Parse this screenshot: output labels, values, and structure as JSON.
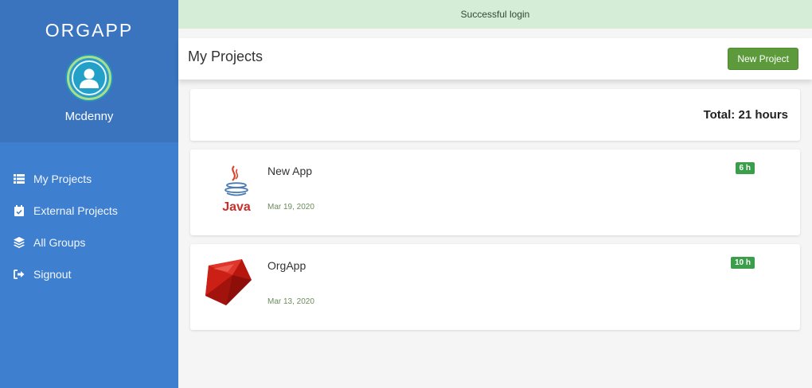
{
  "flash": {
    "message": "Successful login"
  },
  "sidebar": {
    "brand": "ORGAPP",
    "username": "Mcdenny",
    "items": [
      {
        "label": "My Projects",
        "icon": "list-icon"
      },
      {
        "label": "External Projects",
        "icon": "calendar-check-icon"
      },
      {
        "label": "All Groups",
        "icon": "layers-icon"
      },
      {
        "label": "Signout",
        "icon": "signout-icon"
      }
    ]
  },
  "header": {
    "title": "My Projects",
    "new_button": "New Project"
  },
  "summary": {
    "total": "Total: 21 hours"
  },
  "projects": [
    {
      "name": "New App",
      "date": "Mar 19, 2020",
      "hours": "6 h",
      "logo": "java-logo",
      "logo_text": "Java"
    },
    {
      "name": "OrgApp",
      "date": "Mar 13, 2020",
      "hours": "10 h",
      "logo": "ruby-logo"
    }
  ],
  "colors": {
    "sidebar": "#3e7fd0",
    "sidebar_top": "#3a74bf",
    "flash_bg": "#d5ecd7",
    "button": "#5c9a3c",
    "badge": "#3a9e4a"
  }
}
